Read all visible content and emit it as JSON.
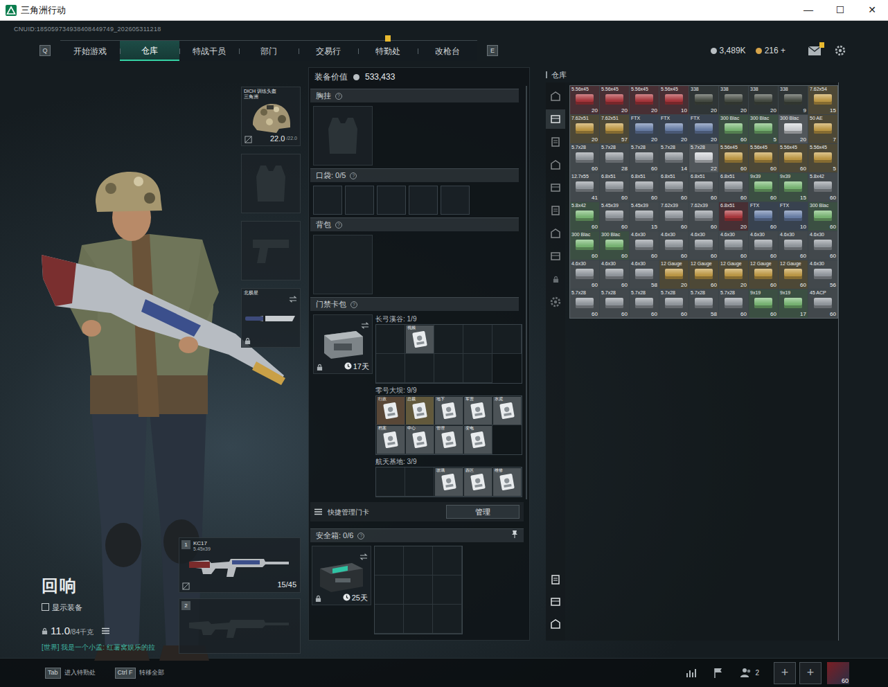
{
  "window": {
    "title": "三角洲行动",
    "controls": [
      "—",
      "☐",
      "✕"
    ]
  },
  "uid": "CNUID:185059734938408449749_202605311218",
  "nav": {
    "left_key": "Q",
    "right_key": "E",
    "tabs": [
      {
        "label": "开始游戏",
        "selected": false,
        "badge": false
      },
      {
        "label": "仓库",
        "selected": true,
        "badge": false
      },
      {
        "label": "特战干员",
        "selected": false,
        "badge": false
      },
      {
        "label": "部门",
        "selected": false,
        "badge": false
      },
      {
        "label": "交易行",
        "selected": false,
        "badge": false
      },
      {
        "label": "特勤处",
        "selected": false,
        "badge": true
      },
      {
        "label": "改枪台",
        "selected": false,
        "badge": false
      }
    ],
    "currencies": [
      {
        "value": "3,489K",
        "kind": "silver"
      },
      {
        "value": "216 +",
        "kind": "gold"
      }
    ],
    "mail_badge": true
  },
  "character": {
    "name": "回响",
    "show_equipment": {
      "label": "显示装备",
      "checked": false
    },
    "weight": "11.0",
    "weight_max": "/84千克",
    "chat": "[世界] 我是一个小孟: 红薯窝娱乐的拉"
  },
  "gear_slots": [
    {
      "kind": "helmet",
      "empty": false,
      "title": "DICH 训练头盔",
      "subtitle": "三角洲",
      "durability": "22.0",
      "durability_max": "/22.0"
    },
    {
      "kind": "armor",
      "empty": true
    },
    {
      "kind": "pistol",
      "empty": true
    },
    {
      "kind": "melee",
      "empty": false,
      "title": "北极星",
      "locked": true
    }
  ],
  "weapons": [
    {
      "slot": "1",
      "empty": false,
      "name": "KC17",
      "caliber": "5.45x39",
      "ammo": "15/45"
    },
    {
      "slot": "2",
      "empty": true
    }
  ],
  "loadout": {
    "value_label": "装备价值",
    "value": "533,433",
    "chest": {
      "label": "胸挂",
      "help": "?"
    },
    "pockets": {
      "label": "口袋: 0/5",
      "help": "?"
    },
    "backpack": {
      "label": "背包",
      "help": "?"
    },
    "keycards": {
      "label": "门禁卡包",
      "help": "?",
      "days": "17天",
      "locked": true,
      "maps": [
        {
          "label": "长弓溪谷: 1/9",
          "cards": [
            {
              "filled": false
            },
            {
              "filled": true,
              "label": "视频",
              "color": "#8a9196"
            },
            {
              "filled": false
            },
            {
              "filled": false
            },
            {
              "filled": false
            },
            {
              "filled": false
            },
            {
              "filled": false
            },
            {
              "filled": false
            },
            {
              "filled": false
            }
          ]
        },
        {
          "label": "零号大坝: 9/9",
          "cards": [
            {
              "filled": true,
              "label": "行政",
              "color": "#b0703a"
            },
            {
              "filled": true,
              "label": "总裁",
              "color": "#c9a24a"
            },
            {
              "filled": true,
              "label": "地下",
              "color": "#8a9196"
            },
            {
              "filled": true,
              "label": "军营",
              "color": "#8a9196"
            },
            {
              "filled": true,
              "label": "水泥",
              "color": "#8a9196"
            },
            {
              "filled": true,
              "label": "档案",
              "color": "#8a9196"
            },
            {
              "filled": true,
              "label": "中心",
              "color": "#8a9196"
            },
            {
              "filled": true,
              "label": "管理",
              "color": "#8a9196"
            },
            {
              "filled": true,
              "label": "变电",
              "color": "#8a9196"
            }
          ]
        },
        {
          "label": "航天基地: 3/9",
          "cards": [
            {
              "filled": false
            },
            {
              "filled": false
            },
            {
              "filled": true,
              "label": "玻璃",
              "color": "#8a9196"
            },
            {
              "filled": true,
              "label": "西区",
              "color": "#8a9196"
            },
            {
              "filled": true,
              "label": "维修",
              "color": "#8a9196"
            }
          ]
        }
      ]
    },
    "quick_manage": {
      "label": "快捷管理门卡",
      "button": "管理"
    },
    "safe_box": {
      "label": "安全箱: 0/6",
      "help": "?",
      "days": "25天",
      "locked": true
    }
  },
  "warehouse": {
    "title": "仓库",
    "side_tabs": [
      {
        "selected": false
      },
      {
        "selected": true
      },
      {
        "selected": false
      },
      {
        "selected": false
      },
      {
        "selected": false
      },
      {
        "selected": false
      },
      {
        "selected": false
      },
      {
        "selected": false
      }
    ],
    "items": [
      {
        "label": "5.56x45",
        "count": "20",
        "color": "#b33a40"
      },
      {
        "label": "5.56x45",
        "count": "20",
        "color": "#b33a40"
      },
      {
        "label": "5.56x45",
        "count": "20",
        "color": "#b33a40"
      },
      {
        "label": "5.56x45",
        "count": "10",
        "color": "#b33a40"
      },
      {
        "label": "338",
        "count": "20",
        "color": "#4b5148"
      },
      {
        "label": "338",
        "count": "20",
        "color": "#4b5148"
      },
      {
        "label": "338",
        "count": "20",
        "color": "#4b5148"
      },
      {
        "label": "338",
        "count": "9",
        "color": "#4b5148"
      },
      {
        "label": "7.62x54",
        "count": "15",
        "color": "#c9a24a"
      },
      {
        "label": "7.62x51",
        "count": "20",
        "color": "#c9a24a"
      },
      {
        "label": "7.62x51",
        "count": "57",
        "color": "#c9a24a"
      },
      {
        "label": "FTX",
        "count": "20",
        "color": "#6f86b0"
      },
      {
        "label": "FTX",
        "count": "20",
        "color": "#6f86b0"
      },
      {
        "label": "FTX",
        "count": "20",
        "color": "#6f86b0"
      },
      {
        "label": "300 Blac",
        "count": "60",
        "color": "#7fbf7a"
      },
      {
        "label": "300 Blac",
        "count": "5",
        "color": "#7fbf7a"
      },
      {
        "label": "300 Blac",
        "count": "20",
        "color": "#d8dade"
      },
      {
        "label": "50 AE",
        "count": "7",
        "color": "#c9a24a"
      },
      {
        "label": "5.7x28",
        "count": "60",
        "color": "#9aa0a6"
      },
      {
        "label": "5.7x28",
        "count": "28",
        "color": "#9aa0a6"
      },
      {
        "label": "5.7x28",
        "count": "60",
        "color": "#9aa0a6"
      },
      {
        "label": "5.7x28",
        "count": "14",
        "color": "#9aa0a6"
      },
      {
        "label": "5.7x28",
        "count": "22",
        "color": "#d8dade"
      },
      {
        "label": "5.56x45",
        "count": "60",
        "color": "#c9a24a"
      },
      {
        "label": "5.56x45",
        "count": "60",
        "color": "#c9a24a"
      },
      {
        "label": "5.56x45",
        "count": "60",
        "color": "#c9a24a"
      },
      {
        "label": "5.56x45",
        "count": "5",
        "color": "#c9a24a"
      },
      {
        "label": "12.7x55",
        "count": "41",
        "color": "#9aa0a6"
      },
      {
        "label": "6.8x51",
        "count": "60",
        "color": "#9aa0a6"
      },
      {
        "label": "6.8x51",
        "count": "60",
        "color": "#9aa0a6"
      },
      {
        "label": "6.8x51",
        "count": "60",
        "color": "#9aa0a6"
      },
      {
        "label": "6.8x51",
        "count": "60",
        "color": "#9aa0a6"
      },
      {
        "label": "6.8x51",
        "count": "60",
        "color": "#9aa0a6"
      },
      {
        "label": "9x39",
        "count": "60",
        "color": "#7fbf7a"
      },
      {
        "label": "9x39",
        "count": "15",
        "color": "#7fbf7a"
      },
      {
        "label": "5.8x42",
        "count": "60",
        "color": "#9aa0a6"
      },
      {
        "label": "5.8x42",
        "count": "60",
        "color": "#7fbf7a"
      },
      {
        "label": "5.45x39",
        "count": "60",
        "color": "#9aa0a6"
      },
      {
        "label": "5.45x39",
        "count": "15",
        "color": "#9aa0a6"
      },
      {
        "label": "7.62x39",
        "count": "60",
        "color": "#9aa0a6"
      },
      {
        "label": "7.62x39",
        "count": "60",
        "color": "#9aa0a6"
      },
      {
        "label": "6.8x51",
        "count": "20",
        "color": "#b33a40"
      },
      {
        "label": "FTX",
        "count": "60",
        "color": "#6f86b0"
      },
      {
        "label": "FTX",
        "count": "10",
        "color": "#6f86b0"
      },
      {
        "label": "300 Blac",
        "count": "60",
        "color": "#7fbf7a"
      },
      {
        "label": "300 Blac",
        "count": "60",
        "color": "#7fbf7a"
      },
      {
        "label": "300 Blac",
        "count": "60",
        "color": "#7fbf7a"
      },
      {
        "label": "4.6x30",
        "count": "60",
        "color": "#9aa0a6"
      },
      {
        "label": "4.6x30",
        "count": "60",
        "color": "#9aa0a6"
      },
      {
        "label": "4.6x30",
        "count": "60",
        "color": "#9aa0a6"
      },
      {
        "label": "4.6x30",
        "count": "60",
        "color": "#9aa0a6"
      },
      {
        "label": "4.6x30",
        "count": "60",
        "color": "#9aa0a6"
      },
      {
        "label": "4.6x30",
        "count": "60",
        "color": "#9aa0a6"
      },
      {
        "label": "4.6x30",
        "count": "60",
        "color": "#9aa0a6"
      },
      {
        "label": "4.6x30",
        "count": "60",
        "color": "#9aa0a6"
      },
      {
        "label": "4.6x30",
        "count": "60",
        "color": "#9aa0a6"
      },
      {
        "label": "4.6x30",
        "count": "58",
        "color": "#9aa0a6"
      },
      {
        "label": "12 Gauge",
        "count": "20",
        "color": "#c9a24a"
      },
      {
        "label": "12 Gauge",
        "count": "60",
        "color": "#c9a24a"
      },
      {
        "label": "12 Gauge",
        "count": "20",
        "color": "#c9a24a"
      },
      {
        "label": "12 Gauge",
        "count": "60",
        "color": "#c9a24a"
      },
      {
        "label": "12 Gauge",
        "count": "60",
        "color": "#c9a24a"
      },
      {
        "label": "4.6x30",
        "count": "56",
        "color": "#9aa0a6"
      },
      {
        "label": "5.7x28",
        "count": "60",
        "color": "#9aa0a6"
      },
      {
        "label": "5.7x28",
        "count": "60",
        "color": "#9aa0a6"
      },
      {
        "label": "5.7x28",
        "count": "60",
        "color": "#9aa0a6"
      },
      {
        "label": "5.7x28",
        "count": "60",
        "color": "#9aa0a6"
      },
      {
        "label": "5.7x28",
        "count": "58",
        "color": "#9aa0a6"
      },
      {
        "label": "5.7x28",
        "count": "60",
        "color": "#9aa0a6"
      },
      {
        "label": "9x19",
        "count": "60",
        "color": "#7fbf7a"
      },
      {
        "label": "9x19",
        "count": "17",
        "color": "#7fbf7a"
      },
      {
        "label": "45 ACP",
        "count": "60",
        "color": "#9aa0a6"
      }
    ]
  },
  "bottom_bar": {
    "hints": [
      {
        "key": "Tab",
        "label": "进入特勤处"
      },
      {
        "key": "Ctrl F",
        "label": "转移全部"
      }
    ],
    "squad_count": "2",
    "plus_slots": [
      "+",
      "+"
    ],
    "level": "60"
  }
}
